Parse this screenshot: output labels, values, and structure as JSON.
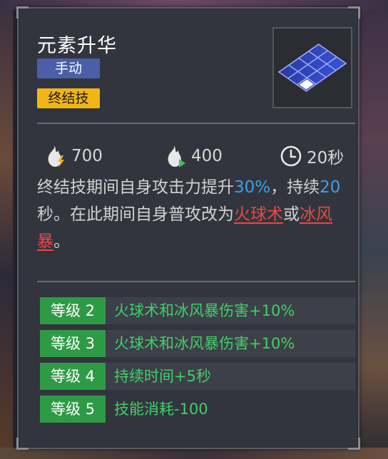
{
  "skill": {
    "name": "元素升华",
    "tags": {
      "manual": "手动",
      "finisher": "终结技"
    }
  },
  "stats": {
    "fire_cost": "700",
    "fire_gain": "400",
    "duration": "20秒"
  },
  "description": {
    "part1": "终结技期间自身攻击力提升",
    "attack_boost": "30%",
    "part2": "，持续",
    "duration_value": "20",
    "part3": "秒。在此期间自身普攻改为",
    "spell1": "火球术",
    "connector": "或",
    "spell2": "冰风暴",
    "end": "。"
  },
  "levels": [
    {
      "badge": "等级 2",
      "effect": "火球术和冰风暴伤害+10%"
    },
    {
      "badge": "等级 3",
      "effect": "火球术和冰风暴伤害+10%"
    },
    {
      "badge": "等级 4",
      "effect": "持续时间+5秒"
    },
    {
      "badge": "等级 5",
      "effect": "技能消耗-100"
    }
  ],
  "colors": {
    "panel_bg": "#32353d",
    "manual_tag": "#4a5fa8",
    "finisher_tag": "#f2b516",
    "highlight_blue": "#3da0e8",
    "highlight_red": "#e84848",
    "level_green": "#2f9a46",
    "level_text": "#3fd06a"
  },
  "icons": {
    "skill": "grid-area-icon",
    "fire_cost": "flame-lightning-icon",
    "fire_gain": "flame-arrow-icon",
    "duration": "clock-icon"
  }
}
